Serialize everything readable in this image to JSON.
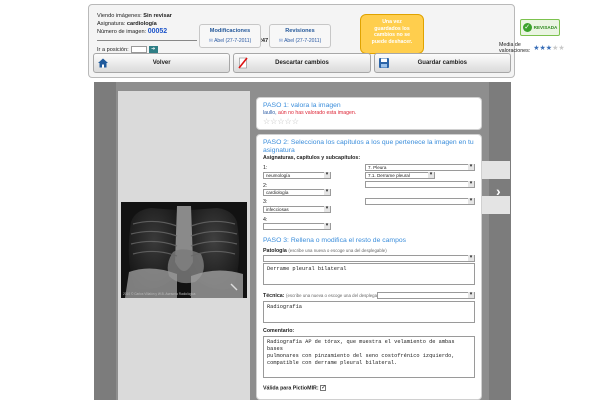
{
  "info": {
    "viewing_label": "Viendo imágenes:",
    "viewing_value": "Sin revisar",
    "subject_label": "Asignatura:",
    "subject_value": "cardiología",
    "image_number_label": "Número de imagen:",
    "image_number": "00052",
    "of_count": "1 de 247",
    "goto_label": "Ir a posición:",
    "goto_value": ""
  },
  "modifications": {
    "title": "Modificaciones",
    "user": "Abel",
    "date": "(27-7-2011)"
  },
  "reviews": {
    "title": "Revisiones",
    "user": "Abel",
    "date": "(27-7-2011)"
  },
  "notice": {
    "lines": [
      "Una vez",
      "guardados los",
      "cambios no se",
      "puede deshacer."
    ]
  },
  "status": {
    "label": "REVISADA",
    "color": "#3aa22b"
  },
  "media": {
    "label": "Media de valoraciones:",
    "rating": 3,
    "max": 5
  },
  "toolbar": {
    "back_label": "Volver",
    "discard_label": "Descartar cambios",
    "save_label": "Guardar cambios"
  },
  "step1": {
    "title": "PASO 1: valora la imagen",
    "user": "laullo,",
    "message": "aún no has valorado esta imagen.",
    "rating": 0
  },
  "step2": {
    "title_line1": "PASO 2: Selecciona los capítulos a los que pertenece la imagen en tu",
    "title_line2": "asignatura",
    "subtitle": "Asignaturas, capítulos y subcapítulos:",
    "rows": [
      {
        "num": "1:",
        "subject": "neumología",
        "chapter": "7. Pleura",
        "subchapter": "7.1. Derrame pleural"
      },
      {
        "num": "2:",
        "subject": "cardiología",
        "chapter": "",
        "subchapter": ""
      },
      {
        "num": "3:",
        "subject": "infecciosas",
        "chapter": "",
        "subchapter": ""
      },
      {
        "num": "4:",
        "subject": "",
        "chapter": "",
        "subchapter": ""
      }
    ]
  },
  "step3": {
    "title": "PASO 3: Rellena o modifica el resto de campos",
    "pathology_label": "Patología",
    "pathology_hint": "(escribe una nueva o escoge una del desplegable)",
    "pathology_value": "Derrame pleural bilateral",
    "technique_label": "Técnica:",
    "technique_hint": "(escribe una nueva o escoge una del desplegable)",
    "technique_value": "Radiografía",
    "comment_label": "Comentario:",
    "comment_line1": "Radiografía AP de tórax, que muestra el velamiento de ambas bases",
    "comment_line2": "pulmonares con pinzamiento del seno costofrénico izquierdo,",
    "comment_line3": "compatible con derrame pleural bilateral.",
    "valid_label": "Válida para PictioMIR:",
    "valid_checked": true
  },
  "xray": {
    "watermark": "2010 © Carlos Villalón y W.B.  Asesoría Radiológica"
  }
}
